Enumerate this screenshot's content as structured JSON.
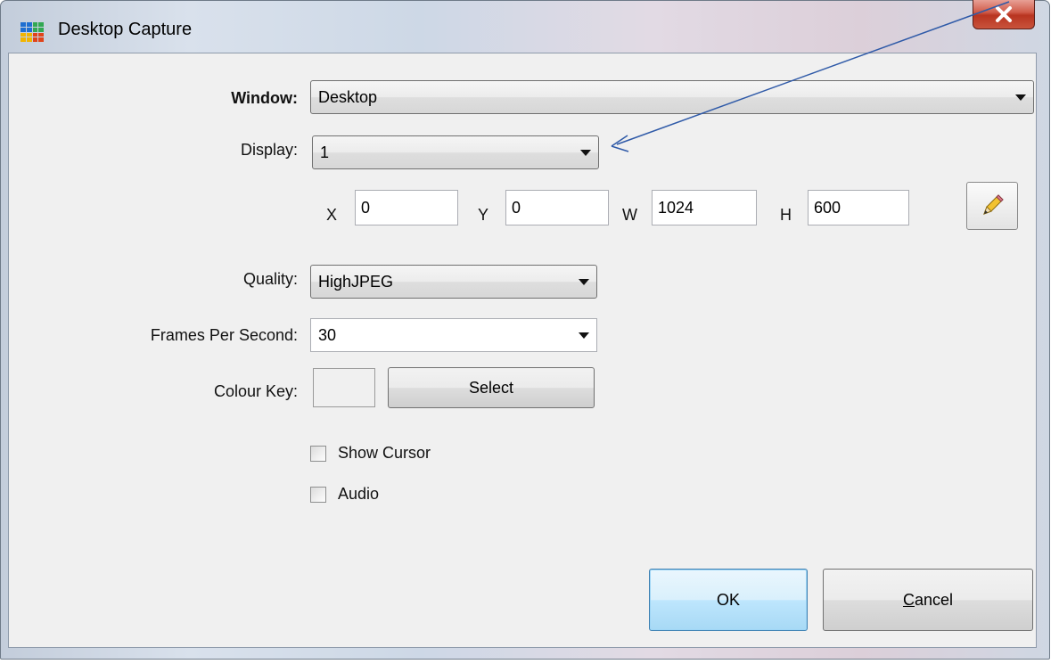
{
  "window": {
    "title": "Desktop Capture",
    "close_glyph": "X",
    "title_icon": "grid-app-icon",
    "title_icon_colors": [
      "#1f6fd1",
      "#32a852",
      "#f2b400",
      "#e0441b"
    ]
  },
  "form": {
    "window_label": "Window:",
    "window_value": "Desktop",
    "display_label": "Display:",
    "display_value": "1",
    "coords": {
      "x_label": "X",
      "x_value": "0",
      "y_label": "Y",
      "y_value": "0",
      "w_label": "W",
      "w_value": "1024",
      "h_label": "H",
      "h_value": "600"
    },
    "pencil_icon": "pencil-icon",
    "quality_label": "Quality:",
    "quality_value": "HighJPEG",
    "fps_label": "Frames Per Second:",
    "fps_value": "30",
    "colour_key_label": "Colour Key:",
    "select_label": "Select",
    "show_cursor_label": "Show Cursor",
    "show_cursor_checked": false,
    "audio_label": "Audio",
    "audio_checked": false
  },
  "buttons": {
    "ok_label": "OK",
    "cancel_prefix": "C",
    "cancel_rest": "ancel"
  },
  "annotation": {
    "arrow_color": "#2f5aa8"
  }
}
